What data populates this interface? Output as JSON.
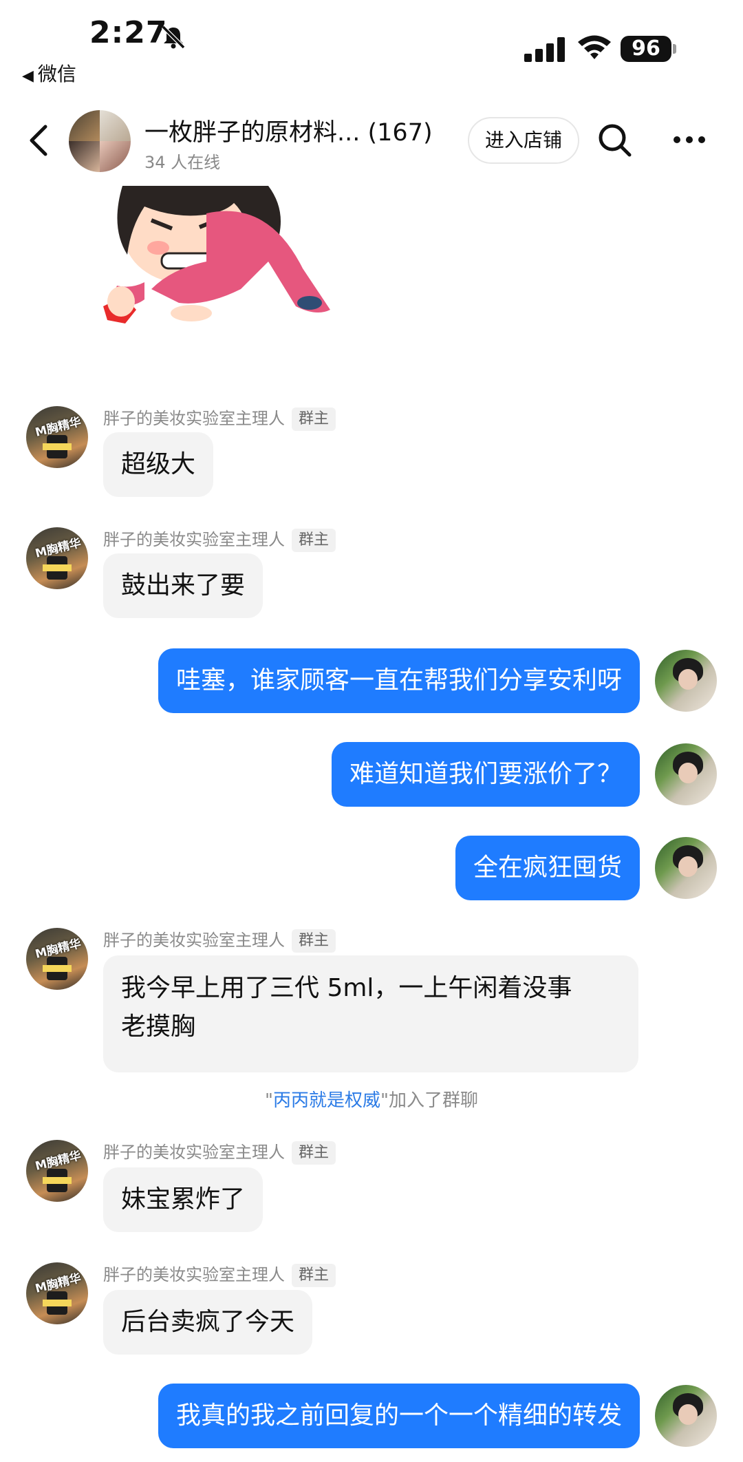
{
  "status_bar": {
    "time": "2:27",
    "back_app": "微信",
    "battery": "96"
  },
  "header": {
    "title": "一枚胖子的原材料... (167)",
    "online": "34 人在线",
    "shop_button": "进入店铺"
  },
  "messages": [
    {
      "type": "in",
      "sender": "胖子的美妆实验室主理人",
      "badge": "群主",
      "text": "超级大"
    },
    {
      "type": "in",
      "sender": "胖子的美妆实验室主理人",
      "badge": "群主",
      "text": "鼓出来了要"
    },
    {
      "type": "out",
      "text": "哇塞，谁家顾客一直在帮我们分享安利呀"
    },
    {
      "type": "out",
      "text": "难道知道我们要涨价了？"
    },
    {
      "type": "out",
      "text": "全在疯狂囤货"
    },
    {
      "type": "in",
      "sender": "胖子的美妆实验室主理人",
      "badge": "群主",
      "line1": "我今早上用了三代 5ml，一上午闲着没事",
      "line2": "老摸胸"
    },
    {
      "type": "system",
      "quote_open": "\"",
      "name": "丙丙就是权威",
      "quote_close": "\"",
      "suffix": "加入了群聊"
    },
    {
      "type": "in",
      "sender": "胖子的美妆实验室主理人",
      "badge": "群主",
      "text": "妹宝累炸了"
    },
    {
      "type": "in",
      "sender": "胖子的美妆实验室主理人",
      "badge": "群主",
      "text": "后台卖疯了今天"
    },
    {
      "type": "out",
      "text": "我真的我之前回复的一个一个精细的转发"
    }
  ],
  "avatar_label": "M胸精华",
  "colors": {
    "accent": "#1f7cff",
    "bubble_in": "#f3f3f3",
    "link": "#2b7be6"
  }
}
